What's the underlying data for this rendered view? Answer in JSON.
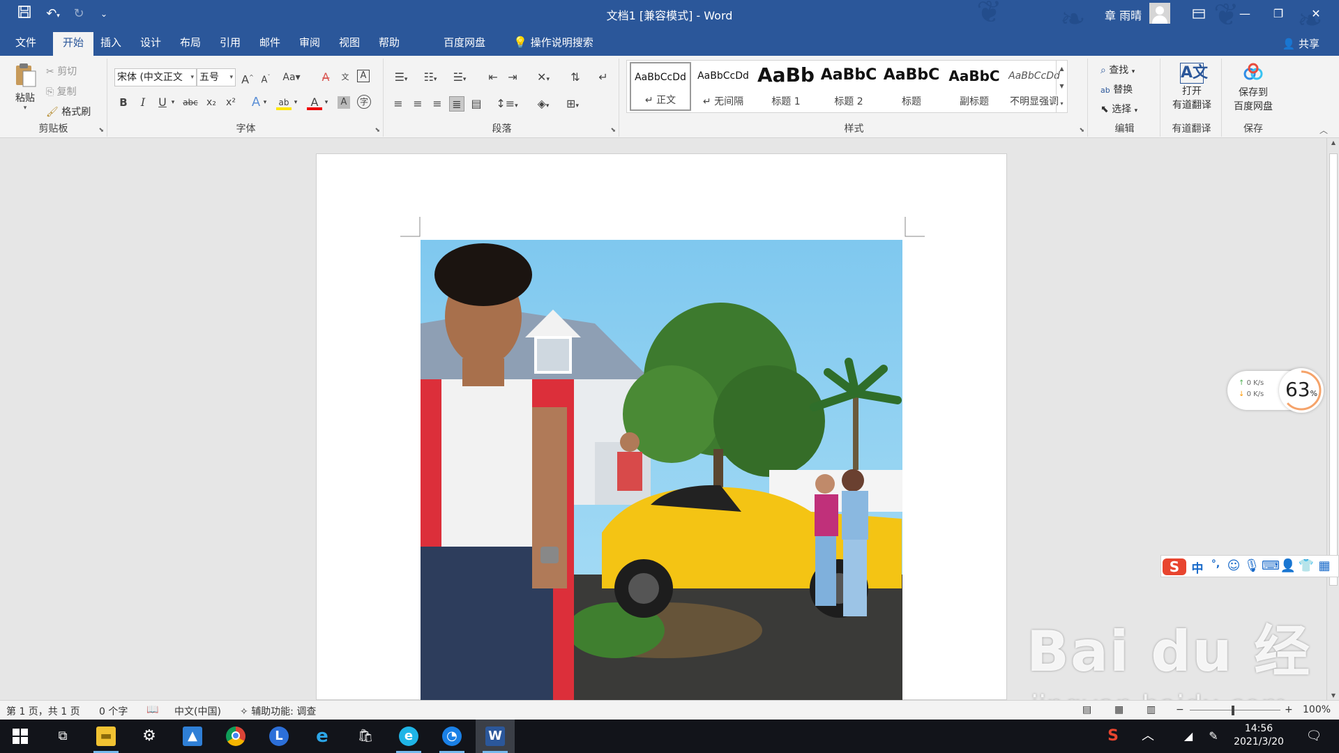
{
  "titlebar": {
    "title": "文档1 [兼容模式]  -  Word",
    "user": "章 雨晴",
    "ribbon_display_icon": "ribbon-display-options-icon",
    "minimize": "—",
    "restore": "❐",
    "close": "✕"
  },
  "menu": {
    "tabs": [
      "文件",
      "开始",
      "插入",
      "设计",
      "布局",
      "引用",
      "邮件",
      "审阅",
      "视图",
      "帮助",
      "百度网盘",
      "操作说明搜索"
    ],
    "active_tab": "开始",
    "share": "共享"
  },
  "ribbon": {
    "clipboard": {
      "paste": "粘贴",
      "cut": "剪切",
      "copy": "复制",
      "format_painter": "格式刷",
      "label": "剪贴板"
    },
    "font": {
      "font_name": "宋体 (中文正文",
      "font_size": "五号",
      "label": "字体"
    },
    "paragraph": {
      "label": "段落"
    },
    "styles": {
      "label": "样式",
      "items": [
        {
          "preview": "AaBbCcDd",
          "name": "↵ 正文"
        },
        {
          "preview": "AaBbCcDd",
          "name": "↵ 无间隔"
        },
        {
          "preview": "AaBb",
          "name": "标题 1"
        },
        {
          "preview": "AaBbC",
          "name": "标题 2"
        },
        {
          "preview": "AaBbC",
          "name": "标题"
        },
        {
          "preview": "AaBbC",
          "name": "副标题"
        },
        {
          "preview": "AaBbCcDd",
          "name": "不明显强调"
        }
      ]
    },
    "editing": {
      "find": "查找",
      "replace": "替换",
      "select": "选择",
      "label": "编辑"
    },
    "youdao": {
      "button_line1": "打开",
      "button_line2": "有道翻译",
      "label": "有道翻译"
    },
    "save_group": {
      "button_line1": "保存到",
      "button_line2": "百度网盘",
      "label": "保存"
    }
  },
  "network_widget": {
    "up": "0  K/s",
    "down": "0  K/s",
    "percent": "63",
    "percent_unit": "%"
  },
  "ime": {
    "mode": "中",
    "punct": "°,"
  },
  "watermark": {
    "main": "Bai du 经验",
    "sub": "jingyan.baidu.com"
  },
  "statusbar": {
    "page": "第 1 页，共 1 页",
    "words": "0 个字",
    "language": "中文(中国)",
    "accessibility": "辅助功能: 调查",
    "zoom": "100%"
  },
  "taskbar": {
    "time": "14:56",
    "date": "2021/3/20"
  }
}
